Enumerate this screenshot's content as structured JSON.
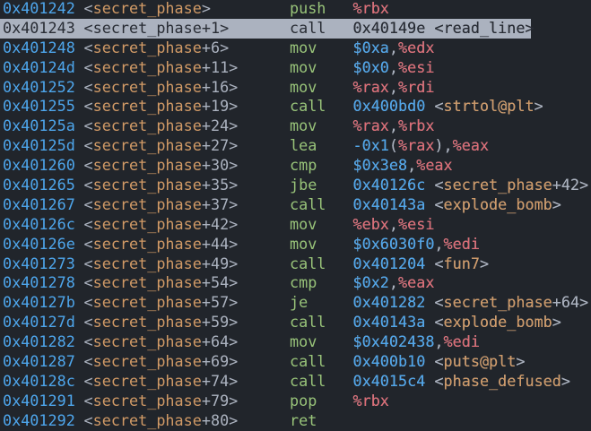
{
  "colors": {
    "background": "#21252b",
    "address": "#4ea6ec",
    "symbol": "#d19a66",
    "mnemonic": "#98c379",
    "register": "#e06c75",
    "immediate": "#4ea6ec",
    "punctuation": "#abb2bf",
    "selection": "#abb2bf"
  },
  "selected_index": 1,
  "rows": [
    {
      "address": "0x401242",
      "symbol": "secret_phase",
      "offset": "",
      "mnemonic": "push",
      "operands": "%rbx"
    },
    {
      "address": "0x401243",
      "symbol": "secret_phase",
      "offset": "+1",
      "mnemonic": "call",
      "operands": "0x40149e <read_line>"
    },
    {
      "address": "0x401248",
      "symbol": "secret_phase",
      "offset": "+6",
      "mnemonic": "mov",
      "operands": "$0xa,%edx"
    },
    {
      "address": "0x40124d",
      "symbol": "secret_phase",
      "offset": "+11",
      "mnemonic": "mov",
      "operands": "$0x0,%esi"
    },
    {
      "address": "0x401252",
      "symbol": "secret_phase",
      "offset": "+16",
      "mnemonic": "mov",
      "operands": "%rax,%rdi"
    },
    {
      "address": "0x401255",
      "symbol": "secret_phase",
      "offset": "+19",
      "mnemonic": "call",
      "operands": "0x400bd0 <strtol@plt>"
    },
    {
      "address": "0x40125a",
      "symbol": "secret_phase",
      "offset": "+24",
      "mnemonic": "mov",
      "operands": "%rax,%rbx"
    },
    {
      "address": "0x40125d",
      "symbol": "secret_phase",
      "offset": "+27",
      "mnemonic": "lea",
      "operands": "-0x1(%rax),%eax"
    },
    {
      "address": "0x401260",
      "symbol": "secret_phase",
      "offset": "+30",
      "mnemonic": "cmp",
      "operands": "$0x3e8,%eax"
    },
    {
      "address": "0x401265",
      "symbol": "secret_phase",
      "offset": "+35",
      "mnemonic": "jbe",
      "operands": "0x40126c <secret_phase+42>"
    },
    {
      "address": "0x401267",
      "symbol": "secret_phase",
      "offset": "+37",
      "mnemonic": "call",
      "operands": "0x40143a <explode_bomb>"
    },
    {
      "address": "0x40126c",
      "symbol": "secret_phase",
      "offset": "+42",
      "mnemonic": "mov",
      "operands": "%ebx,%esi"
    },
    {
      "address": "0x40126e",
      "symbol": "secret_phase",
      "offset": "+44",
      "mnemonic": "mov",
      "operands": "$0x6030f0,%edi"
    },
    {
      "address": "0x401273",
      "symbol": "secret_phase",
      "offset": "+49",
      "mnemonic": "call",
      "operands": "0x401204 <fun7>"
    },
    {
      "address": "0x401278",
      "symbol": "secret_phase",
      "offset": "+54",
      "mnemonic": "cmp",
      "operands": "$0x2,%eax"
    },
    {
      "address": "0x40127b",
      "symbol": "secret_phase",
      "offset": "+57",
      "mnemonic": "je",
      "operands": "0x401282 <secret_phase+64>"
    },
    {
      "address": "0x40127d",
      "symbol": "secret_phase",
      "offset": "+59",
      "mnemonic": "call",
      "operands": "0x40143a <explode_bomb>"
    },
    {
      "address": "0x401282",
      "symbol": "secret_phase",
      "offset": "+64",
      "mnemonic": "mov",
      "operands": "$0x402438,%edi"
    },
    {
      "address": "0x401287",
      "symbol": "secret_phase",
      "offset": "+69",
      "mnemonic": "call",
      "operands": "0x400b10 <puts@plt>"
    },
    {
      "address": "0x40128c",
      "symbol": "secret_phase",
      "offset": "+74",
      "mnemonic": "call",
      "operands": "0x4015c4 <phase_defused>"
    },
    {
      "address": "0x401291",
      "symbol": "secret_phase",
      "offset": "+79",
      "mnemonic": "pop",
      "operands": "%rbx"
    },
    {
      "address": "0x401292",
      "symbol": "secret_phase",
      "offset": "+80",
      "mnemonic": "ret",
      "operands": ""
    }
  ]
}
